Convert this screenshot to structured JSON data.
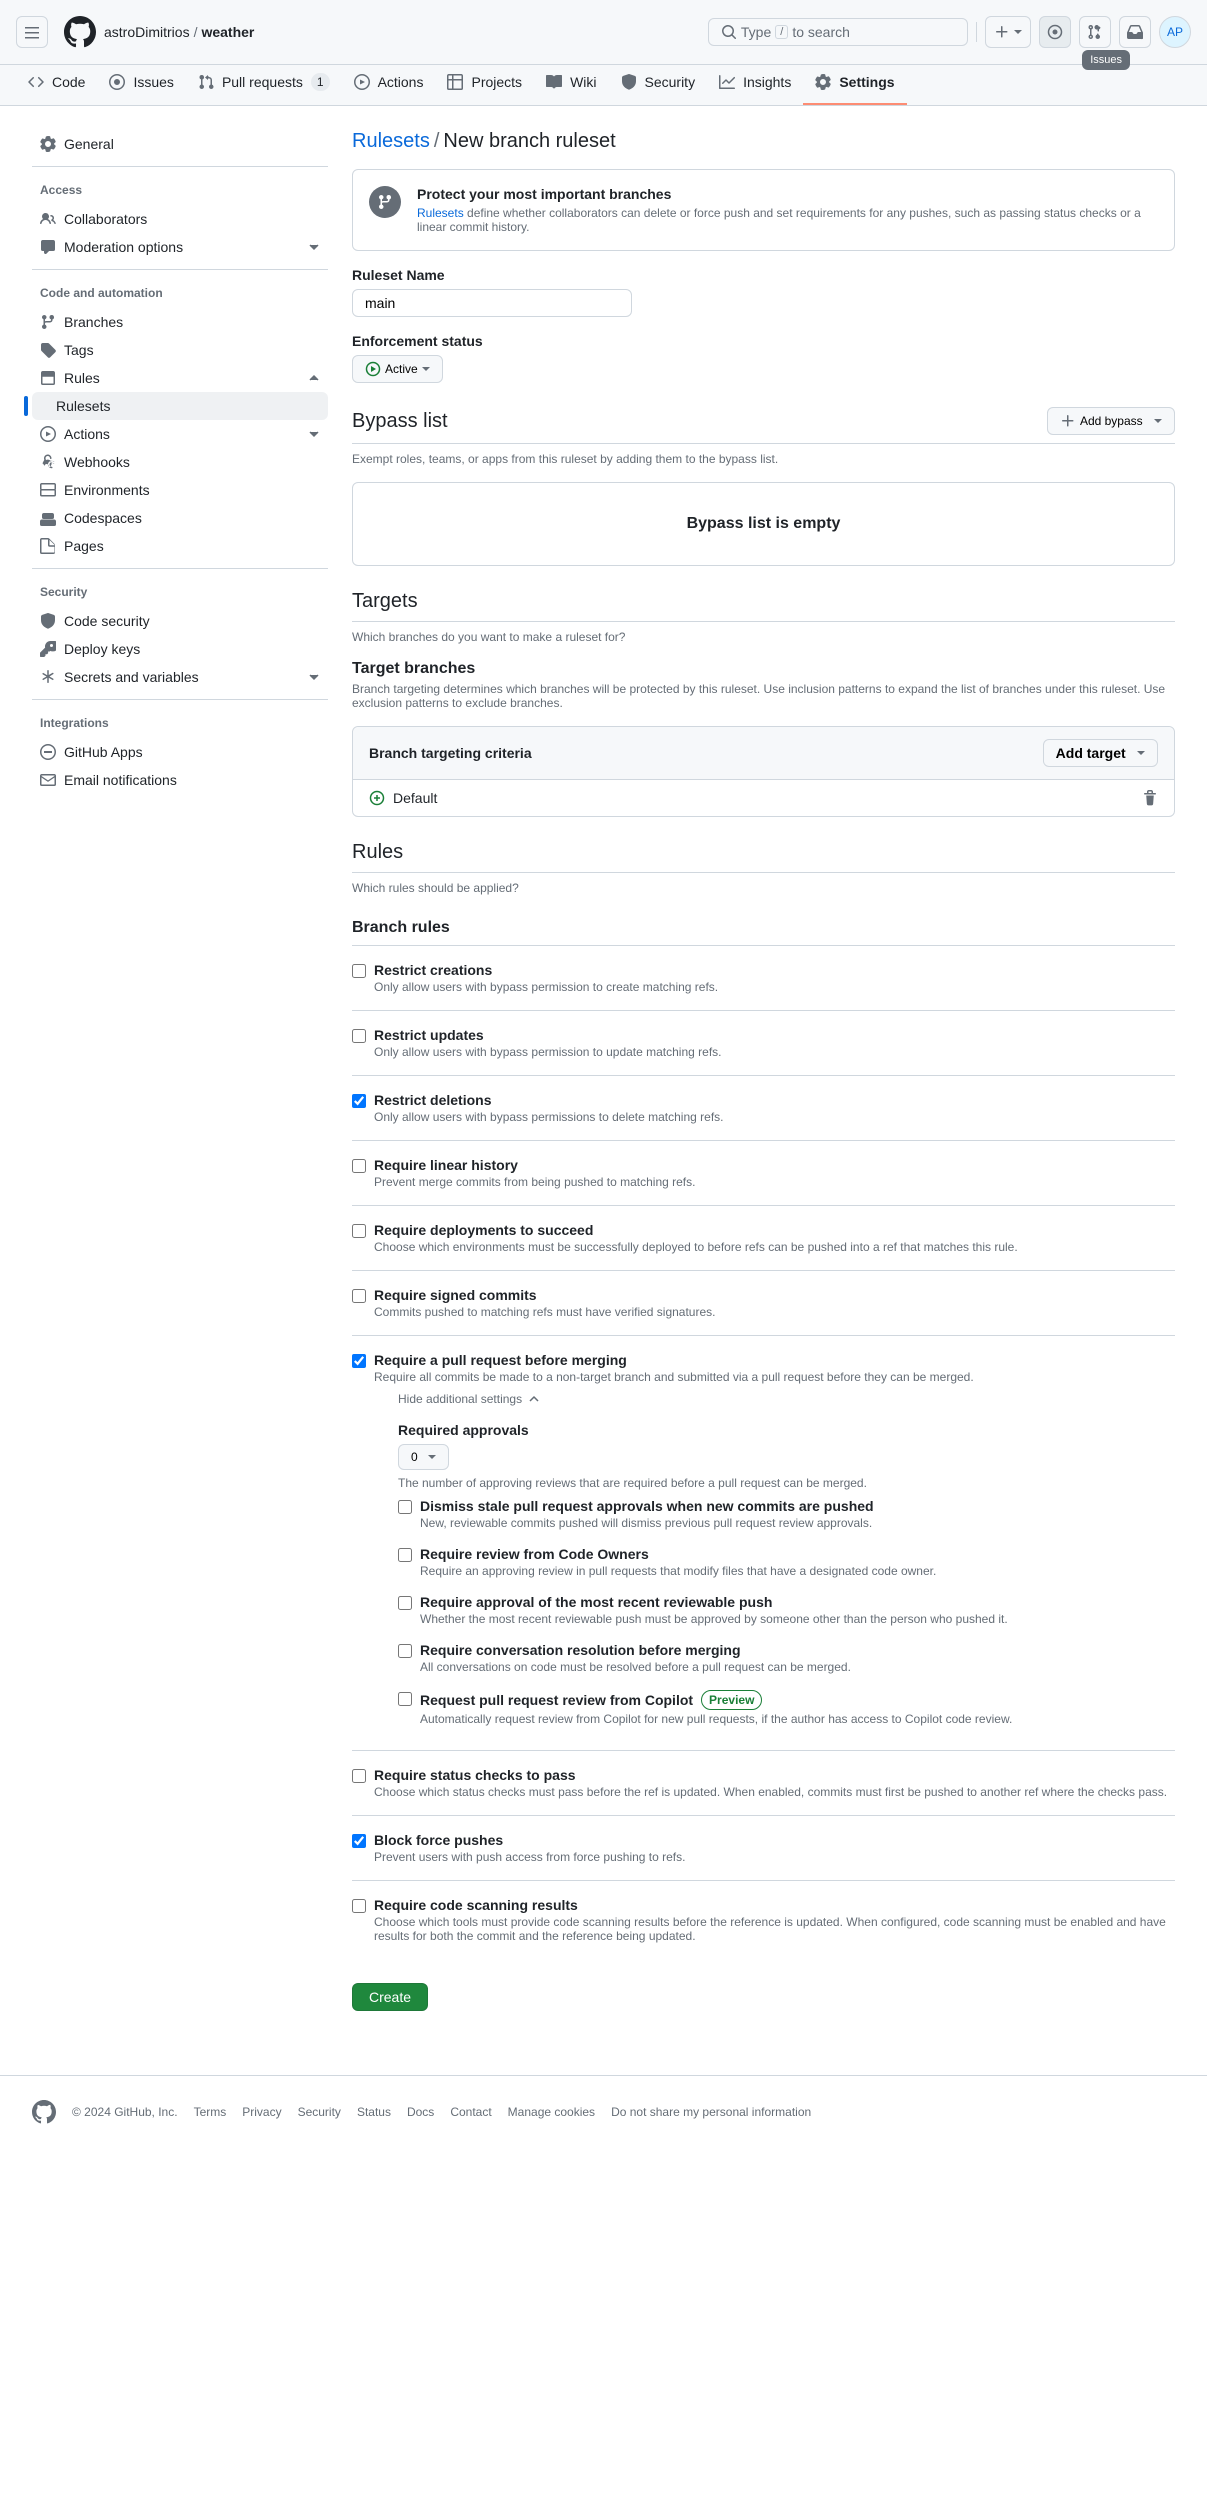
{
  "header": {
    "owner": "astroDimitrios",
    "repo": "weather",
    "search_hint": "Type",
    "search_hint2": "to search",
    "avatar": "AP",
    "tooltip": "Issues"
  },
  "tabs": [
    {
      "label": "Code",
      "icon": "code"
    },
    {
      "label": "Issues",
      "icon": "issue"
    },
    {
      "label": "Pull requests",
      "icon": "pr",
      "count": "1"
    },
    {
      "label": "Actions",
      "icon": "play"
    },
    {
      "label": "Projects",
      "icon": "table"
    },
    {
      "label": "Wiki",
      "icon": "book"
    },
    {
      "label": "Security",
      "icon": "shield"
    },
    {
      "label": "Insights",
      "icon": "graph"
    },
    {
      "label": "Settings",
      "icon": "gear",
      "active": true
    }
  ],
  "sidebar": {
    "general": "General",
    "groups": [
      {
        "title": "Access",
        "items": [
          {
            "label": "Collaborators",
            "icon": "people"
          },
          {
            "label": "Moderation options",
            "icon": "comment",
            "expand": true
          }
        ]
      },
      {
        "title": "Code and automation",
        "items": [
          {
            "label": "Branches",
            "icon": "branch"
          },
          {
            "label": "Tags",
            "icon": "tag"
          },
          {
            "label": "Rules",
            "icon": "rules",
            "expand": true,
            "open": true,
            "sub": [
              {
                "label": "Rulesets",
                "selected": true
              }
            ]
          },
          {
            "label": "Actions",
            "icon": "play",
            "expand": true
          },
          {
            "label": "Webhooks",
            "icon": "webhook"
          },
          {
            "label": "Environments",
            "icon": "server"
          },
          {
            "label": "Codespaces",
            "icon": "codespace"
          },
          {
            "label": "Pages",
            "icon": "pages"
          }
        ]
      },
      {
        "title": "Security",
        "items": [
          {
            "label": "Code security",
            "icon": "shield"
          },
          {
            "label": "Deploy keys",
            "icon": "key"
          },
          {
            "label": "Secrets and variables",
            "icon": "asterisk",
            "expand": true
          }
        ]
      },
      {
        "title": "Integrations",
        "items": [
          {
            "label": "GitHub Apps",
            "icon": "hubot"
          },
          {
            "label": "Email notifications",
            "icon": "mail"
          }
        ]
      }
    ]
  },
  "breadcrumb": {
    "link": "Rulesets",
    "current": "New branch ruleset"
  },
  "info": {
    "title": "Protect your most important branches",
    "link": "Rulesets",
    "text": "define whether collaborators can delete or force push and set requirements for any pushes, such as passing status checks or a linear commit history."
  },
  "form": {
    "name_label": "Ruleset Name",
    "name_value": "main",
    "enforce_label": "Enforcement status",
    "enforce_value": "Active"
  },
  "bypass": {
    "title": "Bypass list",
    "btn": "Add bypass",
    "desc": "Exempt roles, teams, or apps from this ruleset by adding them to the bypass list.",
    "empty": "Bypass list is empty"
  },
  "targets": {
    "title": "Targets",
    "desc": "Which branches do you want to make a ruleset for?",
    "sub": "Target branches",
    "subdesc": "Branch targeting determines which branches will be protected by this ruleset. Use inclusion patterns to expand the list of branches under this ruleset. Use exclusion patterns to exclude branches.",
    "criteria": "Branch targeting criteria",
    "addbtn": "Add target",
    "default": "Default"
  },
  "rulessec": {
    "title": "Rules",
    "desc": "Which rules should be applied?",
    "subhead": "Branch rules"
  },
  "rules": [
    {
      "t": "Restrict creations",
      "d": "Only allow users with bypass permission to create matching refs."
    },
    {
      "t": "Restrict updates",
      "d": "Only allow users with bypass permission to update matching refs."
    },
    {
      "t": "Restrict deletions",
      "d": "Only allow users with bypass permissions to delete matching refs.",
      "c": true
    },
    {
      "t": "Require linear history",
      "d": "Prevent merge commits from being pushed to matching refs."
    },
    {
      "t": "Require deployments to succeed",
      "d": "Choose which environments must be successfully deployed to before refs can be pushed into a ref that matches this rule."
    },
    {
      "t": "Require signed commits",
      "d": "Commits pushed to matching refs must have verified signatures."
    },
    {
      "t": "Require a pull request before merging",
      "d": "Require all commits be made to a non-target branch and submitted via a pull request before they can be merged.",
      "c": true,
      "pr": true
    },
    {
      "t": "Require status checks to pass",
      "d": "Choose which status checks must pass before the ref is updated. When enabled, commits must first be pushed to another ref where the checks pass."
    },
    {
      "t": "Block force pushes",
      "d": "Prevent users with push access from force pushing to refs.",
      "c": true
    },
    {
      "t": "Require code scanning results",
      "d": "Choose which tools must provide code scanning results before the reference is updated. When configured, code scanning must be enabled and have results for both the commit and the reference being updated."
    }
  ],
  "pr": {
    "toggle": "Hide additional settings",
    "approvals_label": "Required approvals",
    "approvals_value": "0",
    "approvals_desc": "The number of approving reviews that are required before a pull request can be merged.",
    "subs": [
      {
        "t": "Dismiss stale pull request approvals when new commits are pushed",
        "d": "New, reviewable commits pushed will dismiss previous pull request review approvals."
      },
      {
        "t": "Require review from Code Owners",
        "d": "Require an approving review in pull requests that modify files that have a designated code owner."
      },
      {
        "t": "Require approval of the most recent reviewable push",
        "d": "Whether the most recent reviewable push must be approved by someone other than the person who pushed it."
      },
      {
        "t": "Require conversation resolution before merging",
        "d": "All conversations on code must be resolved before a pull request can be merged."
      },
      {
        "t": "Request pull request review from Copilot",
        "d": "Automatically request review from Copilot for new pull requests, if the author has access to Copilot code review.",
        "badge": "Preview"
      }
    ]
  },
  "create": "Create",
  "footer": {
    "copy": "© 2024 GitHub, Inc.",
    "links": [
      "Terms",
      "Privacy",
      "Security",
      "Status",
      "Docs",
      "Contact",
      "Manage cookies",
      "Do not share my personal information"
    ]
  }
}
